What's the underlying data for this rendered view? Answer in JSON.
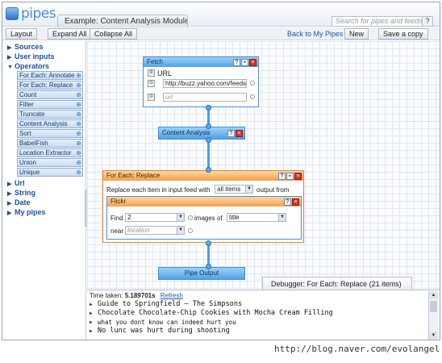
{
  "app": {
    "logo_text": "pipes",
    "doc_tab_title": "Example: Content Analysis Module",
    "search_placeholder": "Search for pipes and feeds",
    "help_label": "?"
  },
  "toolbar": {
    "layout_label": "Layout",
    "expand_label": "Expand All",
    "collapse_label": "Collapse All",
    "back_label": "Back to My Pipes",
    "new_label": "New",
    "save_copy_label": "Save a copy"
  },
  "sidebar": {
    "categories": [
      {
        "label": "Sources",
        "expanded": false
      },
      {
        "label": "User inputs",
        "expanded": false
      },
      {
        "label": "Operators",
        "expanded": true
      },
      {
        "label": "Url",
        "expanded": false
      },
      {
        "label": "String",
        "expanded": false
      },
      {
        "label": "Date",
        "expanded": false
      },
      {
        "label": "My pipes",
        "expanded": false
      }
    ],
    "operators": [
      "For Each: Annotate",
      "For Each: Replace",
      "Count",
      "Filter",
      "Truncate",
      "Content Analysis",
      "Sort",
      "BabelFish",
      "Location Extractor",
      "Union",
      "Unique"
    ]
  },
  "modules": {
    "fetch": {
      "title": "Fetch",
      "url_label": "URL",
      "url_value": "http://buzz.yahoo.com/feeds",
      "url2_placeholder": "url"
    },
    "content_analysis": {
      "title": "Content Analysis"
    },
    "foreach": {
      "title": "For Each: Replace",
      "desc_prefix": "Replace each item in input feed with",
      "desc_select": "all items",
      "desc_suffix": "output from"
    },
    "flickr": {
      "title": "Flickr",
      "find_label": "Find",
      "find_value": "2",
      "images_of_label": "images of",
      "images_of_value": "title",
      "near_label": "near",
      "near_placeholder": "location"
    },
    "pipe_output": {
      "title": "Pipe Output"
    }
  },
  "debugger": {
    "tab_label": "Debugger: For Each: Replace (21 items)",
    "time_label": "Time taken:",
    "time_value": "5.189701s",
    "refresh_label": "Refresh",
    "items": [
      "Guide to Springfield — The Simpsons",
      "Chocolate Chocolate-Chip Cookies with Mocha Cream Filling",
      "what you dont know can indeed hurt you",
      "No lunc was hurt during shooting"
    ]
  },
  "footer_url": "http://blog.naver.com/evolangel",
  "colors": {
    "module_blue": "#4ea2e6",
    "module_orange": "#f5a04a",
    "wire": "#4aa0e8",
    "link": "#2255aa"
  }
}
